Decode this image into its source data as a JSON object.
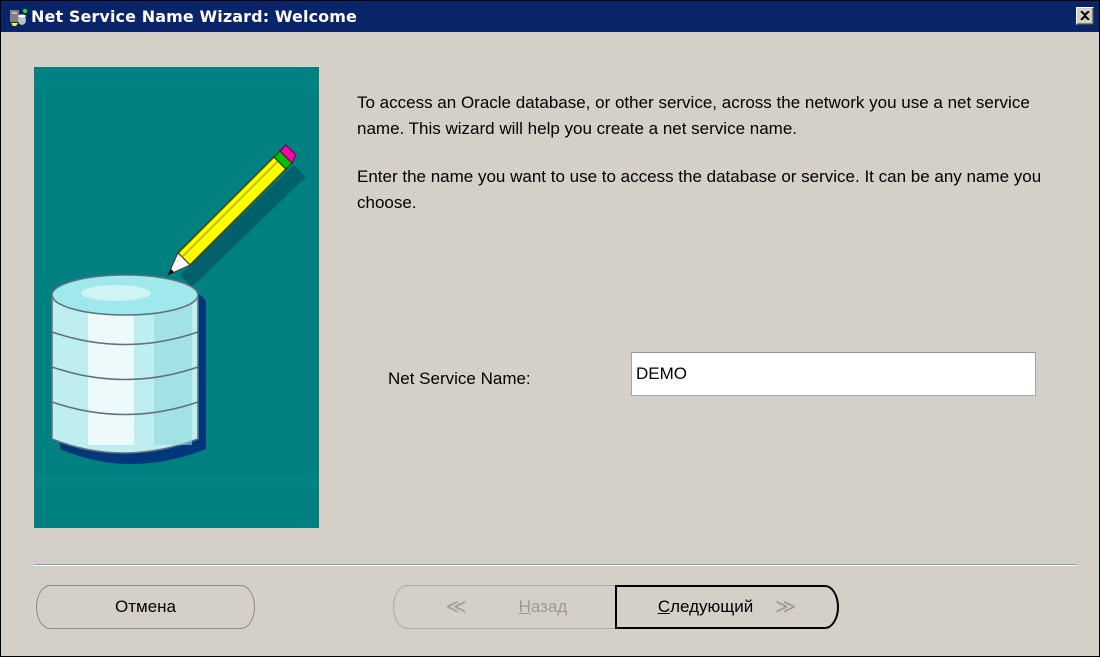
{
  "window": {
    "title": "Net Service Name Wizard: Welcome"
  },
  "description": {
    "paragraph1": "To access an Oracle database, or other service, across the network you use a net service name.  This wizard will help you create a net service name.",
    "paragraph2": "Enter the name you want to use to access the database or service.  It can be any name you choose."
  },
  "form": {
    "net_service_name_label": "Net Service Name:",
    "net_service_name_value": "DEMO"
  },
  "buttons": {
    "cancel_label": "Отмена",
    "back_mnemonic": "Н",
    "back_rest": "азад",
    "back_arrow": "≪",
    "next_mnemonic": "С",
    "next_rest": "ледующий",
    "next_arrow": "≫"
  },
  "colors": {
    "title_bar": "#0a246a",
    "dialog_bg": "#d4d0c8",
    "art_panel": "#008080",
    "separator": "#7fa6b4"
  },
  "icons": {
    "window_icon": "oracle-net-icon",
    "close_icon": "close-icon",
    "illustration": "database-pencil-illustration"
  }
}
